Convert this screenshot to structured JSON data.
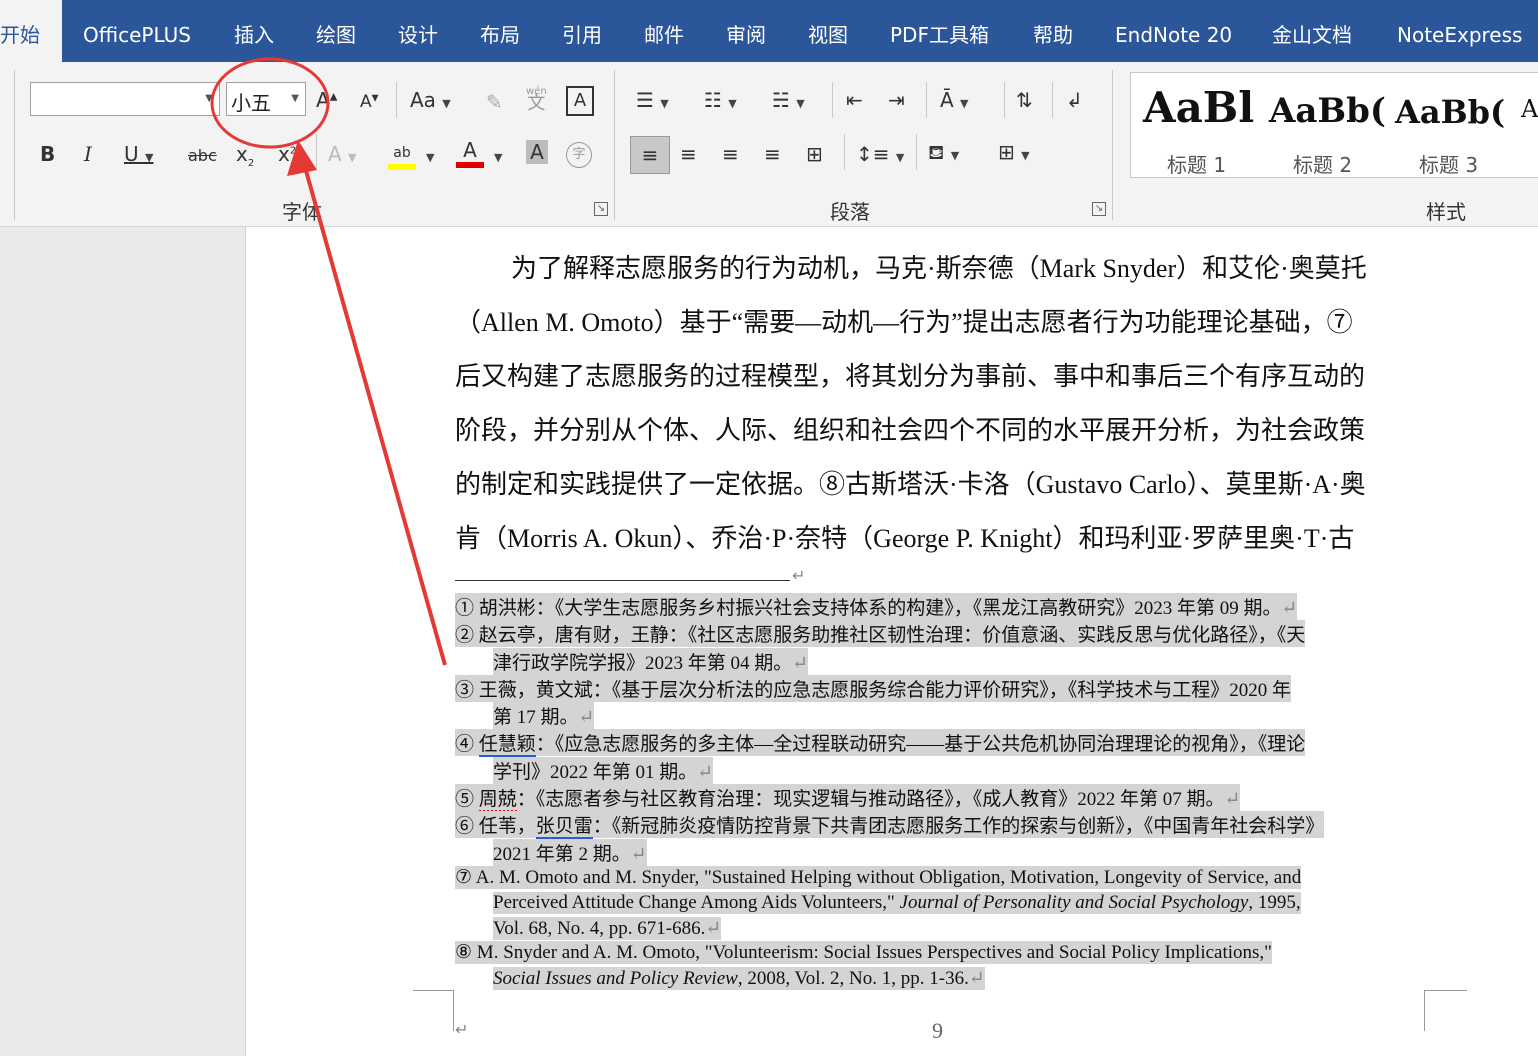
{
  "tabs": [
    "开始",
    "OfficePLUS",
    "插入",
    "绘图",
    "设计",
    "布局",
    "引用",
    "邮件",
    "审阅",
    "视图",
    "PDF工具箱",
    "帮助",
    "EndNote 20",
    "金山文档",
    "NoteExpress"
  ],
  "active_tab": "开始",
  "ribbon": {
    "font_group": {
      "label": "字体",
      "font_name": "",
      "font_size": "小五",
      "change_case": "Aa",
      "phonetic_glyph": "wén",
      "phonetic_char": "文"
    },
    "paragraph_group": {
      "label": "段落"
    },
    "styles_group": {
      "label": "样式",
      "samples": [
        "AaBl",
        "AaBb(",
        "AaBb(",
        "A"
      ],
      "names": [
        "标题 1",
        "标题 2",
        "标题 3"
      ]
    }
  },
  "annotation": {
    "circle_color": "#e53935",
    "arrow_color": "#e53935"
  },
  "document": {
    "body_lines": [
      "为了解释志愿服务的行为动机，马克·斯奈德（Mark Snyder）和艾伦·奥莫托",
      "（Allen  M.  Omoto）基于“需要—动机—行为”提出志愿者行为功能理论基础，⑦",
      "后又构建了志愿服务的过程模型，将其划分为事前、事中和事后三个有序互动的",
      "阶段，并分别从个体、人际、组织和社会四个不同的水平展开分析，为社会政策",
      "的制定和实践提供了一定依据。⑧古斯塔沃·卡洛（Gustavo Carlo）、莫里斯·A·奥",
      "肯（Morris A. Okun）、乔治·P·奈特（George P. Knight）和玛利亚·罗萨里奥·T·古"
    ],
    "footnotes": [
      {
        "num": "①",
        "lines": [
          "胡洪彬：《大学生志愿服务乡村振兴社会支持体系的构建》，《黑龙江高教研究》2023 年第 09 期。"
        ]
      },
      {
        "num": "②",
        "lines": [
          "赵云亭，唐有财，王静：《社区志愿服务助推社区韧性治理：价值意涵、实践反思与优化路径》，《天",
          "津行政学院学报》2023 年第 04 期。"
        ]
      },
      {
        "num": "③",
        "lines": [
          "王薇，黄文斌：《基于层次分析法的应急志愿服务综合能力评价研究》，《科学技术与工程》2020 年",
          "第 17 期。"
        ]
      },
      {
        "num": "④",
        "author": "任慧颖",
        "lines": [
          "：《应急志愿服务的多主体—全过程联动研究——基于公共危机协同治理理论的视角》，《理论",
          "学刊》2022 年第 01 期。"
        ]
      },
      {
        "num": "⑤",
        "author": "周兢",
        "lines": [
          "：《志愿者参与社区教育治理：现实逻辑与推动路径》，《成人教育》2022 年第 07 期。"
        ]
      },
      {
        "num": "⑥",
        "author_prefix": "任苇，",
        "author": "张贝雷",
        "lines": [
          "：《新冠肺炎疫情防控背景下共青团志愿服务工作的探索与创新》，《中国青年社会科学》",
          "2021 年第 2 期。"
        ]
      },
      {
        "num": "⑦",
        "lines": [
          "A. M. Omoto and M. Snyder, \"Sustained Helping without Obligation, Motivation, Longevity of Service, and",
          "Perceived Attitude Change Among Aids Volunteers,\" ",
          "Journal of Personality and Social Psychology",
          "Vol. 68, No. 4, pp. 671-686."
        ],
        "year": ", 1995,"
      },
      {
        "num": "⑧",
        "lines": [
          "M. Snyder and A. M. Omoto, \"Volunteerism: Social Issues Perspectives and Social Policy Implications,\"",
          "Social Issues and Policy Review",
          ", 2008, Vol. 2, No. 1, pp. 1-36."
        ]
      }
    ],
    "para_mark": "↵",
    "page_number": "9"
  }
}
